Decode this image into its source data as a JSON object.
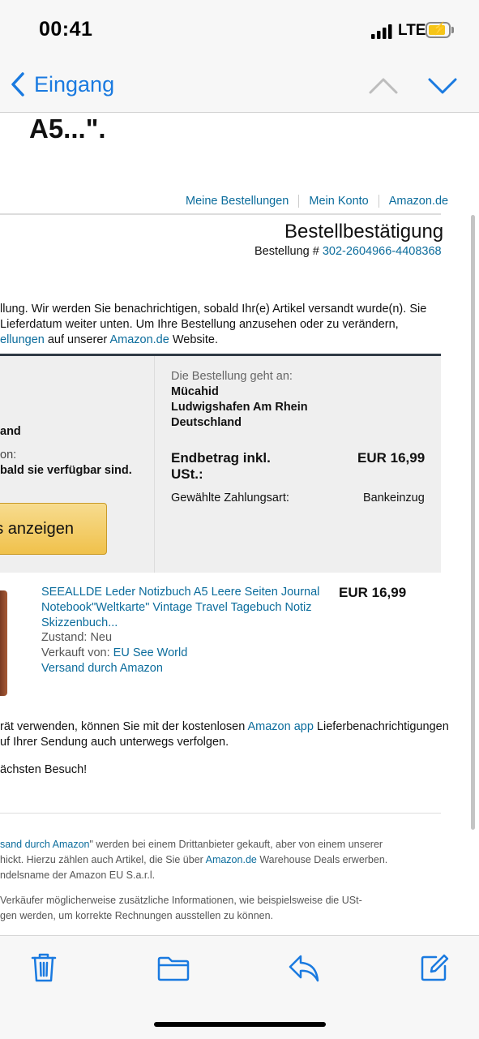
{
  "status_bar": {
    "time": "00:41",
    "network": "LTE",
    "icons": [
      "signal-icon",
      "battery-charging-icon"
    ]
  },
  "nav": {
    "back_label": "Eingang",
    "icons": [
      "chevron-left-icon",
      "chevron-up-icon",
      "chevron-down-icon"
    ]
  },
  "subject_fragment": "A5...\".",
  "header_links": {
    "orders": "Meine Bestellungen",
    "account": "Mein Konto",
    "site": "Amazon.de"
  },
  "confirmation": {
    "title": "Bestellbestätigung",
    "order_prefix": "Bestellung #",
    "order_number": "302-2604966-4408368"
  },
  "intro": {
    "line1": "llung. Wir werden Sie benachrichtigen, sobald Ihr(e) Artikel versandt wurde(n). Sie",
    "line2": " Lieferdatum weiter unten. Um Ihre Bestellung anzusehen oder zu verändern,",
    "line3_link": "ellungen",
    "line3_mid": " auf unserer ",
    "line3_link2": "Amazon.de",
    "line3_end": " Website."
  },
  "summary": {
    "left": {
      "line1": "and",
      "line2": "on:",
      "line3": "bald sie verfügbar sind.",
      "button": "s anzeigen"
    },
    "ship_to_label": "Die Bestellung geht an:",
    "ship_to": [
      "Mücahid",
      "Ludwigshafen Am Rhein",
      "Deutschland"
    ],
    "total_label": "Endbetrag inkl. USt.:",
    "total_value": "EUR 16,99",
    "payment_label": "Gewählte Zahlungsart:",
    "payment_value": "Bankeinzug"
  },
  "item": {
    "title": "SEEALLDE Leder Notizbuch A5 Leere Seiten Journal Notebook\"Weltkarte\" Vintage Travel Tagebuch Notiz Skizzenbuch...",
    "price": "EUR 16,99",
    "condition": "Zustand: Neu",
    "sold_by_label": "Verkauft von: ",
    "sold_by": "EU See World",
    "shipping": "Versand durch Amazon"
  },
  "app_note": {
    "line1_start": "rät verwenden, können Sie mit der kostenlosen ",
    "line1_link": "Amazon app",
    "line1_end": " Lieferbenachrichtigungen",
    "line2": "uf Ihrer Sendung auch unterwegs verfolgen."
  },
  "closing": "ächsten Besuch!",
  "footer": {
    "p1_link": "sand durch Amazon",
    "p1_line1_end": "\" werden bei einem Drittanbieter gekauft, aber von einem unserer",
    "p1_line2_start": "hickt. Hierzu zählen auch Artikel, die Sie über ",
    "p1_line2_link": "Amazon.de",
    "p1_line2_end": " Warehouse Deals erwerben.",
    "p1_line3": "ndelsname der Amazon EU S.a.r.l.",
    "p2_line1": "Verkäufer möglicherweise zusätzliche Informationen, wie beispielsweise die USt-",
    "p2_line2": "gen werden, um korrekte Rechnungen ausstellen zu können."
  },
  "toolbar": {
    "icons": [
      "trash-icon",
      "folder-icon",
      "reply-icon",
      "compose-icon"
    ]
  },
  "colors": {
    "link": "#0b6c9c",
    "ios_blue": "#1a7ae0",
    "button": "#f0c14b"
  }
}
